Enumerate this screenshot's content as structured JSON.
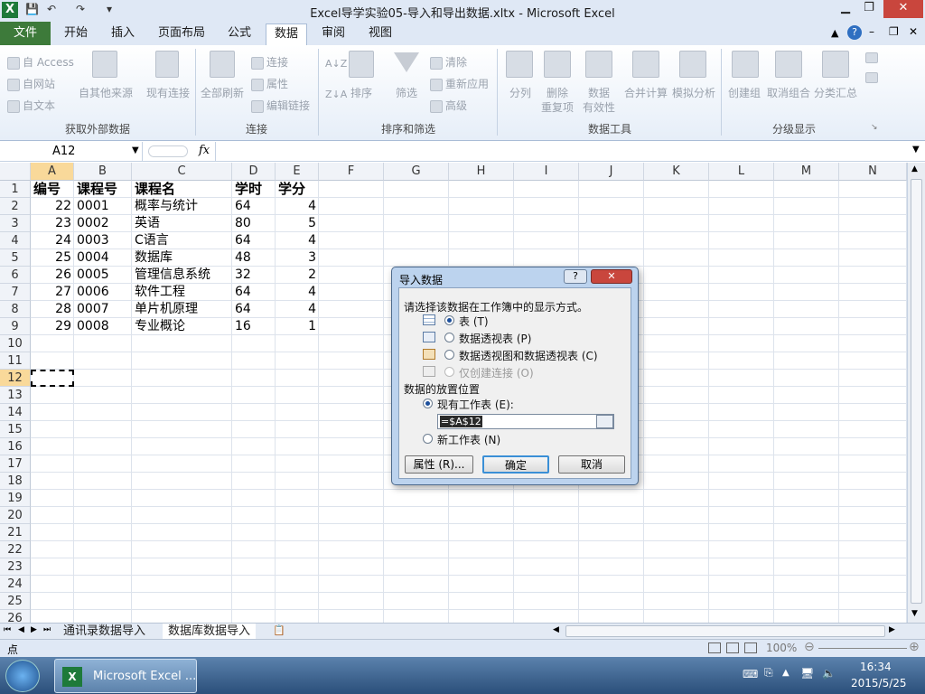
{
  "app": {
    "title": "Excel导学实验05-导入和导出数据.xltx - Microsoft Excel"
  },
  "tabs": [
    "文件",
    "开始",
    "插入",
    "页面布局",
    "公式",
    "数据",
    "审阅",
    "视图"
  ],
  "active_tab": "数据",
  "ribbon": {
    "groups": [
      "获取外部数据",
      "连接",
      "排序和筛选",
      "数据工具",
      "分级显示"
    ],
    "access": "自 Access",
    "web": "自网站",
    "text": "自文本",
    "other_sources": "自其他来源",
    "existing_conn": "现有连接",
    "refresh_all": "全部刷新",
    "connections": "连接",
    "properties": "属性",
    "edit_links": "编辑链接",
    "sort_az": "A↓Z",
    "sort": "排序",
    "filter": "筛选",
    "clear": "清除",
    "reapply": "重新应用",
    "advanced": "高级",
    "text_to_columns": "分列",
    "remove_dup_1": "删除",
    "remove_dup_2": "重复项",
    "validation_1": "数据",
    "validation_2": "有效性",
    "consolidate": "合并计算",
    "whatif": "模拟分析",
    "group": "创建组",
    "ungroup": "取消组合",
    "subtotal": "分类汇总"
  },
  "namebox": "A12",
  "fx": "fx",
  "columns": [
    "A",
    "B",
    "C",
    "D",
    "E",
    "F",
    "G",
    "H",
    "I",
    "J",
    "K",
    "L",
    "M",
    "N"
  ],
  "rows": [
    "1",
    "2",
    "3",
    "4",
    "5",
    "6",
    "7",
    "8",
    "9",
    "10",
    "11",
    "12",
    "13",
    "14",
    "15",
    "16",
    "17",
    "18",
    "19",
    "20",
    "21",
    "22",
    "23",
    "24",
    "25",
    "26"
  ],
  "table": {
    "headers": [
      "编号",
      "课程号",
      "课程名",
      "学时",
      "学分"
    ],
    "records": [
      [
        "22",
        "0001",
        "概率与统计",
        "64",
        "4"
      ],
      [
        "23",
        "0002",
        "英语",
        "80",
        "5"
      ],
      [
        "24",
        "0003",
        "C语言",
        "64",
        "4"
      ],
      [
        "25",
        "0004",
        "数据库",
        "48",
        "3"
      ],
      [
        "26",
        "0005",
        "管理信息系统",
        "32",
        "2"
      ],
      [
        "27",
        "0006",
        "软件工程",
        "64",
        "4"
      ],
      [
        "28",
        "0007",
        "单片机原理",
        "64",
        "4"
      ],
      [
        "29",
        "0008",
        "专业概论",
        "16",
        "1"
      ]
    ]
  },
  "sheets": [
    "通讯录数据导入",
    "数据库数据导入"
  ],
  "status": {
    "mode": "点",
    "zoom": "100%"
  },
  "taskbar": {
    "app": "Microsoft Excel ...",
    "time": "16:34",
    "date": "2015/5/25"
  },
  "dialog": {
    "title": "导入数据",
    "help": "?",
    "close": "✕",
    "prompt": "请选择该数据在工作簿中的显示方式。",
    "opt_table": "表 (T)",
    "opt_pivot": "数据透视表 (P)",
    "opt_pivotchart": "数据透视图和数据透视表 (C)",
    "opt_conn": "仅创建连接 (O)",
    "place_label": "数据的放置位置",
    "existing": "现有工作表 (E):",
    "range": "=$A$12",
    "new_sheet": "新工作表 (N)",
    "btn_props": "属性 (R)...",
    "btn_ok": "确定",
    "btn_cancel": "取消"
  }
}
